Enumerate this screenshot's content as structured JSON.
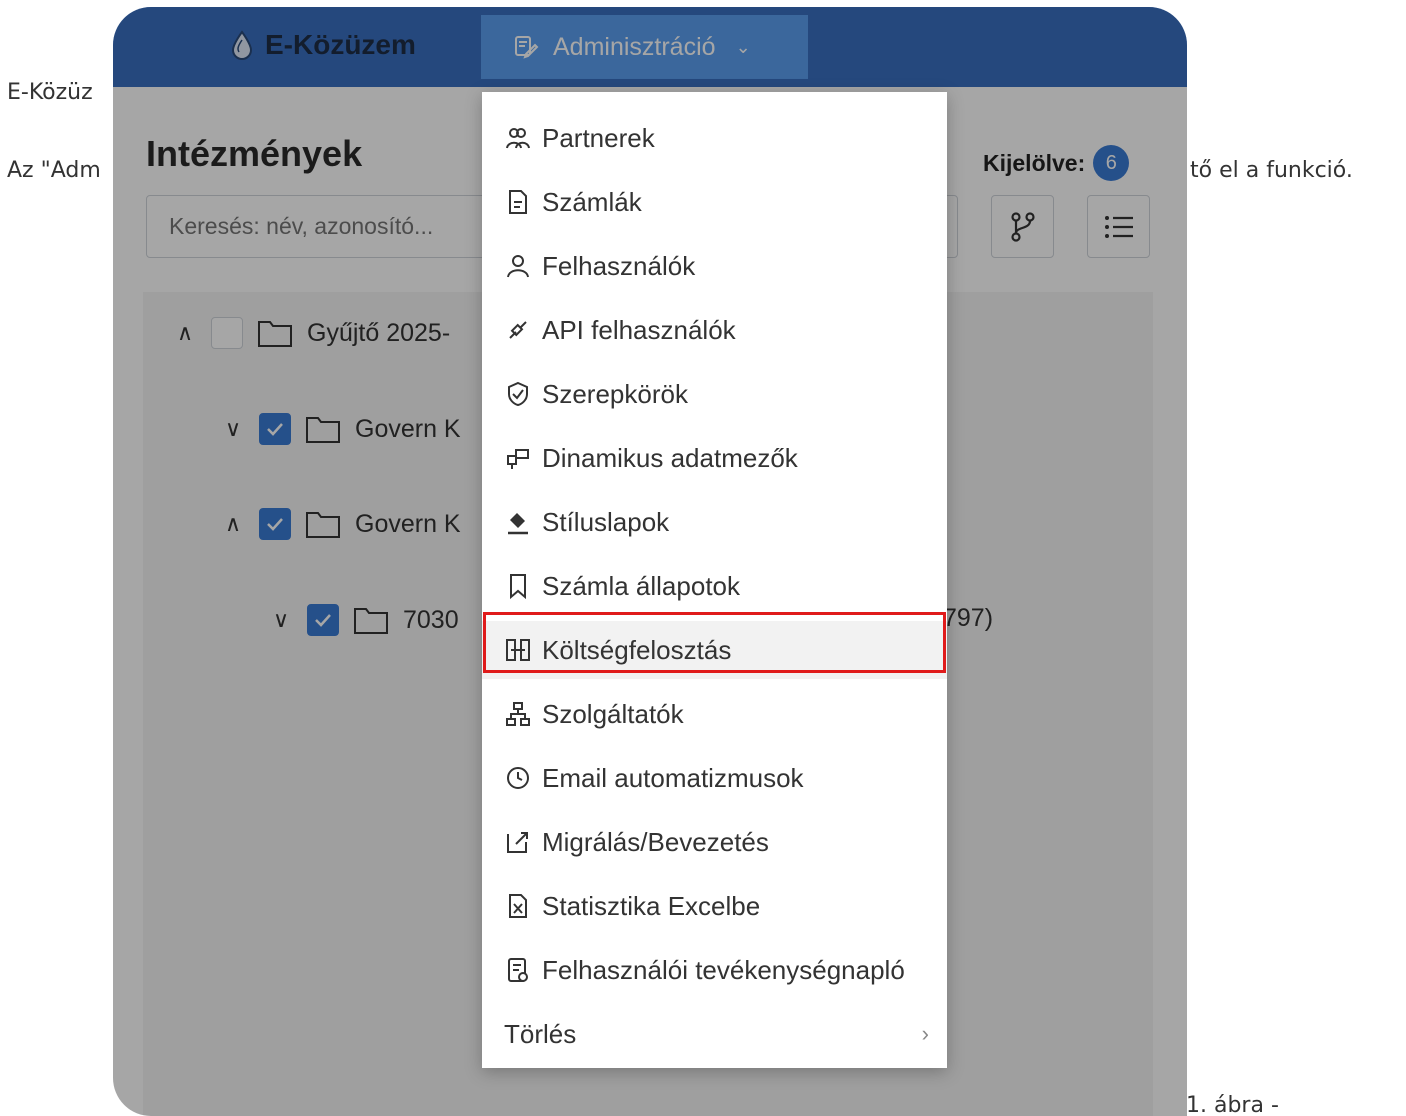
{
  "document": {
    "line1": "E-Közüz",
    "line2_start": "Az \"Adm",
    "line2_end": "tő el a funkció.",
    "caption": "1. ábra -"
  },
  "app": {
    "brand": "E-Közüzem",
    "nav": {
      "admin_label": "Adminisztráció",
      "chevron": "⌄"
    },
    "page_title": "Intézmények",
    "selected": {
      "label": "Kijelölve:",
      "count": "6"
    },
    "search": {
      "placeholder": "Keresés: név, azonosító..."
    },
    "tree": [
      {
        "caret": "∧",
        "checked": false,
        "label": "Gyűjtő 2025-"
      },
      {
        "caret": "∨",
        "checked": true,
        "label": "Govern K"
      },
      {
        "caret": "∧",
        "checked": true,
        "label": "Govern K"
      },
      {
        "caret": "∨",
        "checked": true,
        "label": "7030"
      }
    ],
    "tree_tail": "797)"
  },
  "menu": {
    "items": [
      {
        "label": "Partnerek",
        "icon": "partners-icon"
      },
      {
        "label": "Számlák",
        "icon": "invoice-icon"
      },
      {
        "label": "Felhasználók",
        "icon": "user-icon"
      },
      {
        "label": "API felhasználók",
        "icon": "api-link-icon"
      },
      {
        "label": "Szerepkörök",
        "icon": "shield-check-icon"
      },
      {
        "label": "Dinamikus adatmezők",
        "icon": "dynamic-fields-icon"
      },
      {
        "label": "Stíluslapok",
        "icon": "paint-bucket-icon"
      },
      {
        "label": "Számla állapotok",
        "icon": "bookmark-icon"
      },
      {
        "label": "Költségfelosztás",
        "icon": "split-icon"
      },
      {
        "label": "Szolgáltatók",
        "icon": "sitemap-icon"
      },
      {
        "label": "Email automatizmusok",
        "icon": "clock-cog-icon"
      },
      {
        "label": "Migrálás/Bevezetés",
        "icon": "migrate-icon"
      },
      {
        "label": "Statisztika Excelbe",
        "icon": "excel-file-icon"
      },
      {
        "label": "Felhasználói tevékenységnapló",
        "icon": "activity-log-icon"
      },
      {
        "label": "Törlés",
        "icon": "",
        "submenu": "›"
      }
    ],
    "highlighted": "Költségfelosztás",
    "highlight_color": "#e01b1b"
  }
}
